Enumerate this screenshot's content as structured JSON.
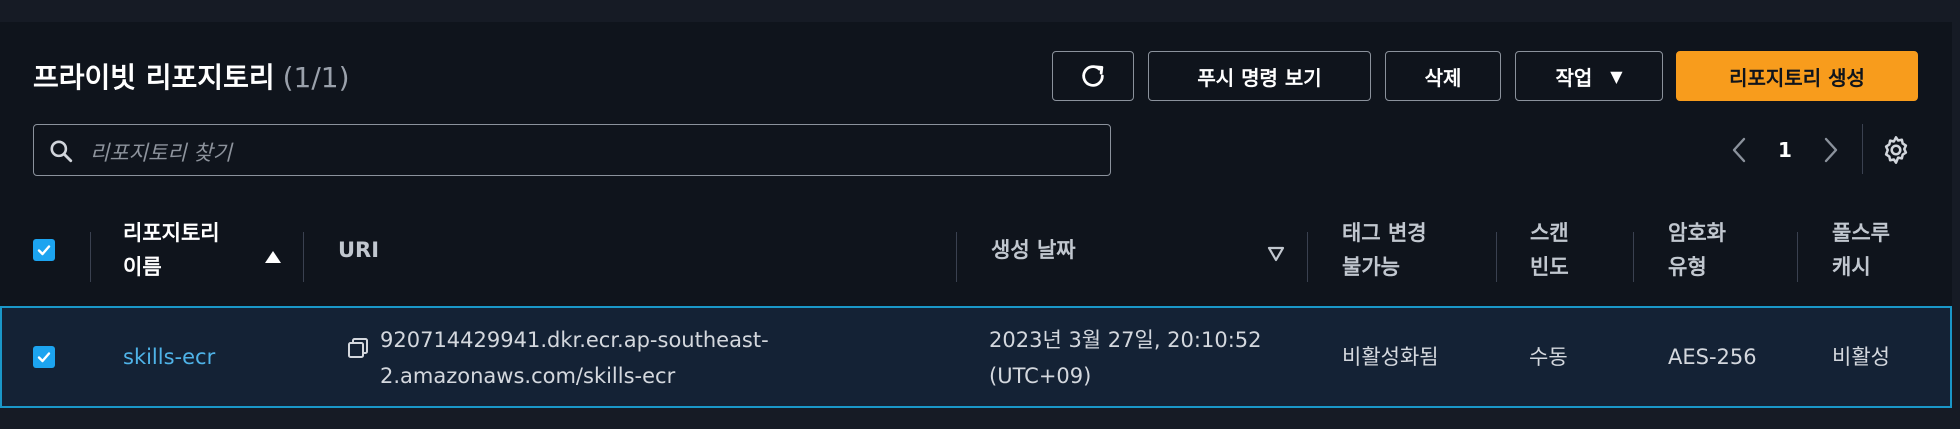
{
  "title": "프라이빗 리포지토리",
  "count": "(1/1)",
  "toolbar": {
    "push_commands": "푸시 명령 보기",
    "delete": "삭제",
    "actions": "작업",
    "create": "리포지토리 생성"
  },
  "search": {
    "placeholder": "리포지토리 찾기"
  },
  "pagination": {
    "current_page": "1"
  },
  "table": {
    "columns": {
      "name": [
        "리포지토리",
        "이름"
      ],
      "uri": "URI",
      "created": "생성 날짜",
      "tag_immutability": [
        "태그 변경",
        "불가능"
      ],
      "scan_frequency": [
        "스캔",
        "빈도"
      ],
      "encryption": [
        "암호화",
        "유형"
      ],
      "pull_through_cache": [
        "풀스루",
        "캐시"
      ]
    },
    "rows": [
      {
        "selected": true,
        "name": "skills-ecr",
        "uri": [
          "920714429941.dkr.ecr.ap-southeast-",
          "2.amazonaws.com/skills-ecr"
        ],
        "created": [
          "2023년 3월 27일, 20:10:52",
          "(UTC+09)"
        ],
        "tag_immutability": "비활성화됨",
        "scan_frequency": "수동",
        "encryption": "AES-256",
        "pull_through_cache": "비활성"
      }
    ]
  },
  "colors": {
    "primary": "#f89c1c",
    "checkbox": "#1ca4f0",
    "link": "#4fb3e8",
    "row_selected_bg": "#142235",
    "row_selected_border": "#1a97c8"
  },
  "icons": [
    "refresh-icon",
    "caret-down-icon",
    "search-icon",
    "chevron-left-icon",
    "chevron-right-icon",
    "settings-icon",
    "copy-icon",
    "sort-ascending-icon",
    "sort-descending-icon",
    "checkbox-checked-icon"
  ]
}
